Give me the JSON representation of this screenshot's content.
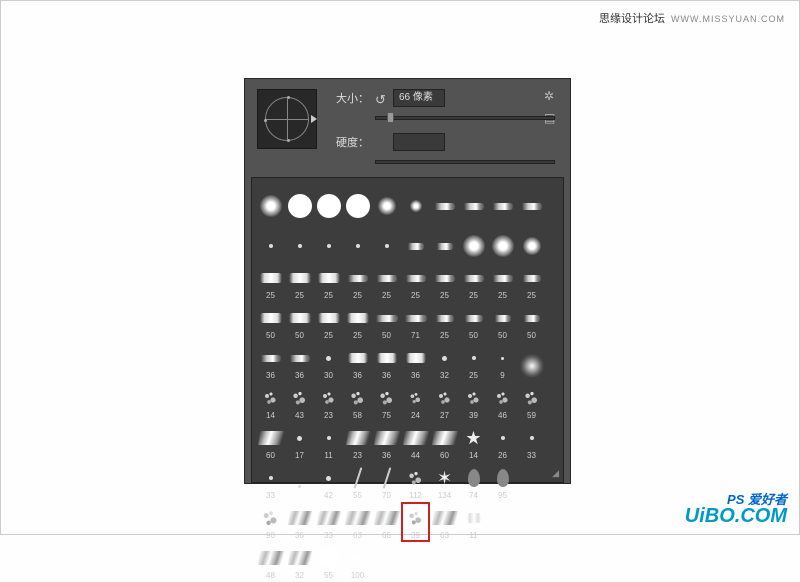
{
  "header": {
    "text": "思缘设计论坛",
    "url": "WWW.MISSYUAN.COM"
  },
  "watermark": {
    "brand": "UiBO.COM",
    "ps": "PS 爱好者"
  },
  "panel": {
    "size_label": "大小：",
    "size_value": "66 像素",
    "hardness_label": "硬度：",
    "hardness_value": "",
    "gear_icon": "✲",
    "doc_icon": "▤",
    "reset_icon": "↺"
  },
  "brushes": [
    {
      "s": "",
      "t": "soft",
      "w": 22
    },
    {
      "s": "",
      "t": "hard",
      "w": 24
    },
    {
      "s": "",
      "t": "hard",
      "w": 24
    },
    {
      "s": "",
      "t": "hard",
      "w": 24
    },
    {
      "s": "",
      "t": "soft",
      "w": 18
    },
    {
      "s": "",
      "t": "soft",
      "w": 12
    },
    {
      "s": "",
      "t": "pencil",
      "w": 20
    },
    {
      "s": "",
      "t": "pencil",
      "w": 20
    },
    {
      "s": "",
      "t": "pencil",
      "w": 20
    },
    {
      "s": "",
      "t": "pencil",
      "w": 20
    },
    {
      "s": "",
      "t": "dot",
      "w": 4
    },
    {
      "s": "",
      "t": "dot",
      "w": 4
    },
    {
      "s": "",
      "t": "dot",
      "w": 4
    },
    {
      "s": "",
      "t": "dot",
      "w": 4
    },
    {
      "s": "",
      "t": "dot",
      "w": 4
    },
    {
      "s": "",
      "t": "pencil",
      "w": 16
    },
    {
      "s": "",
      "t": "pencil",
      "w": 16
    },
    {
      "s": "",
      "t": "soft",
      "w": 22
    },
    {
      "s": "",
      "t": "soft",
      "w": 22
    },
    {
      "s": "",
      "t": "soft",
      "w": 18
    },
    {
      "s": "25",
      "t": "chalk",
      "w": 22
    },
    {
      "s": "25",
      "t": "chalk",
      "w": 22
    },
    {
      "s": "25",
      "t": "chalk",
      "w": 22
    },
    {
      "s": "25",
      "t": "pencil",
      "w": 20
    },
    {
      "s": "25",
      "t": "pencil",
      "w": 20
    },
    {
      "s": "25",
      "t": "pencil",
      "w": 20
    },
    {
      "s": "25",
      "t": "pencil",
      "w": 20
    },
    {
      "s": "25",
      "t": "pencil",
      "w": 20
    },
    {
      "s": "25",
      "t": "pencil",
      "w": 20
    },
    {
      "s": "25",
      "t": "pencil",
      "w": 18
    },
    {
      "s": "50",
      "t": "chalk",
      "w": 22
    },
    {
      "s": "50",
      "t": "chalk",
      "w": 22
    },
    {
      "s": "25",
      "t": "chalk",
      "w": 22
    },
    {
      "s": "25",
      "t": "chalk",
      "w": 22
    },
    {
      "s": "50",
      "t": "pencil",
      "w": 22
    },
    {
      "s": "71",
      "t": "pencil",
      "w": 22
    },
    {
      "s": "25",
      "t": "pencil",
      "w": 18
    },
    {
      "s": "50",
      "t": "pencil",
      "w": 18
    },
    {
      "s": "50",
      "t": "pencil",
      "w": 16
    },
    {
      "s": "50",
      "t": "pencil",
      "w": 16
    },
    {
      "s": "36",
      "t": "pencil",
      "w": 20
    },
    {
      "s": "36",
      "t": "pencil",
      "w": 20
    },
    {
      "s": "30",
      "t": "dot",
      "w": 5
    },
    {
      "s": "36",
      "t": "chalk",
      "w": 20
    },
    {
      "s": "36",
      "t": "chalk",
      "w": 20
    },
    {
      "s": "36",
      "t": "chalk",
      "w": 20
    },
    {
      "s": "32",
      "t": "dot",
      "w": 5
    },
    {
      "s": "25",
      "t": "dot",
      "w": 4
    },
    {
      "s": "9",
      "t": "dot",
      "w": 3
    },
    {
      "s": "",
      "t": "spray",
      "w": 24
    },
    {
      "s": "14",
      "t": "scatter",
      "w": 20
    },
    {
      "s": "43",
      "t": "scatter",
      "w": 22
    },
    {
      "s": "23",
      "t": "scatter",
      "w": 20
    },
    {
      "s": "58",
      "t": "scatter",
      "w": 22
    },
    {
      "s": "75",
      "t": "scatter",
      "w": 22
    },
    {
      "s": "24",
      "t": "scatter",
      "w": 18
    },
    {
      "s": "27",
      "t": "scatter",
      "w": 20
    },
    {
      "s": "39",
      "t": "scatter",
      "w": 20
    },
    {
      "s": "46",
      "t": "scatter",
      "w": 20
    },
    {
      "s": "59",
      "t": "scatter",
      "w": 22
    },
    {
      "s": "60",
      "t": "smear",
      "w": 24
    },
    {
      "s": "17",
      "t": "dot",
      "w": 5
    },
    {
      "s": "11",
      "t": "dot",
      "w": 4
    },
    {
      "s": "23",
      "t": "smear",
      "w": 22
    },
    {
      "s": "36",
      "t": "smear",
      "w": 24
    },
    {
      "s": "44",
      "t": "smear",
      "w": 24
    },
    {
      "s": "60",
      "t": "smear",
      "w": 24
    },
    {
      "s": "14",
      "t": "star",
      "glyph": "★"
    },
    {
      "s": "26",
      "t": "dot",
      "w": 4
    },
    {
      "s": "33",
      "t": "dot",
      "w": 4
    },
    {
      "s": "33",
      "t": "dot",
      "w": 4
    },
    {
      "s": "",
      "t": "dot",
      "w": 3
    },
    {
      "s": "42",
      "t": "dot",
      "w": 5
    },
    {
      "s": "55",
      "t": "stroke"
    },
    {
      "s": "70",
      "t": "stroke"
    },
    {
      "s": "112",
      "t": "scatter",
      "w": 22
    },
    {
      "s": "134",
      "t": "star",
      "glyph": "✶"
    },
    {
      "s": "74",
      "t": "drop"
    },
    {
      "s": "95",
      "t": "drop"
    },
    {
      "s": "",
      "t": ""
    },
    {
      "s": "90",
      "t": "scatter",
      "w": 24
    },
    {
      "s": "36",
      "t": "smear",
      "w": 22
    },
    {
      "s": "33",
      "t": "smear",
      "w": 22
    },
    {
      "s": "63",
      "t": "smear",
      "w": 24
    },
    {
      "s": "66",
      "t": "smear",
      "w": 24
    },
    {
      "s": "39",
      "t": "scatter",
      "w": 22,
      "sel": true
    },
    {
      "s": "63",
      "t": "smear",
      "w": 24
    },
    {
      "s": "11",
      "t": "chalk",
      "w": 14
    },
    {
      "s": "",
      "t": ""
    },
    {
      "s": "",
      "t": ""
    },
    {
      "s": "48",
      "t": "smear",
      "w": 24
    },
    {
      "s": "32",
      "t": "smear",
      "w": 22
    },
    {
      "s": "55",
      "t": "hard",
      "w": 20
    },
    {
      "s": "100",
      "t": "spray",
      "w": 24
    }
  ]
}
